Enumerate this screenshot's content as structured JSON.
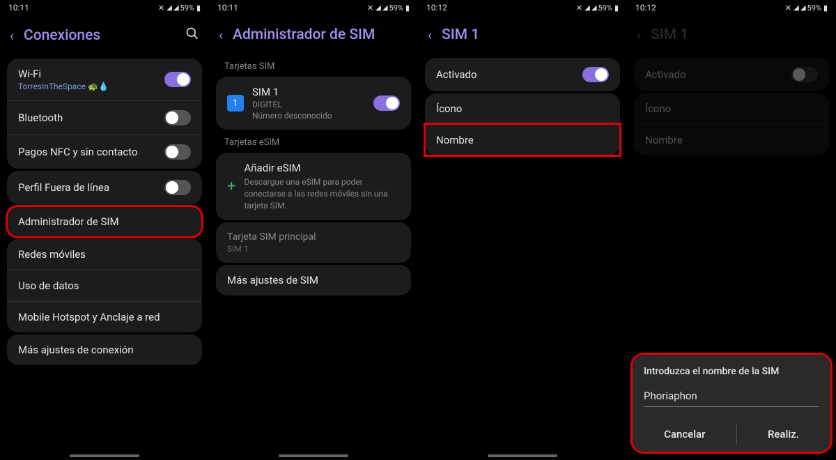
{
  "status": {
    "time1": "10:11",
    "time2": "10:11",
    "time3": "10:12",
    "time4": "10:12",
    "battery": "59%"
  },
  "screen1": {
    "title": "Conexiones",
    "wifi": {
      "label": "Wi-Fi",
      "ssid": "TorresInTheSpace 🐢💧"
    },
    "bluetooth": "Bluetooth",
    "nfc": "Pagos NFC y sin contacto",
    "offline": "Perfil Fuera de línea",
    "sim_manager": "Administrador de SIM",
    "mobile_networks": "Redes móviles",
    "data_usage": "Uso de datos",
    "hotspot": "Mobile Hotspot y Anclaje a red",
    "more": "Más ajustes de conexión"
  },
  "screen2": {
    "title": "Administrador de SIM",
    "section_sim": "Tarjetas SIM",
    "sim1": {
      "name": "SIM 1",
      "carrier": "DIGITEL",
      "number": "Número desconocido",
      "badge": "1"
    },
    "section_esim": "Tarjetas eSIM",
    "add_esim": {
      "label": "Añadir eSIM",
      "desc": "Descargue una eSIM para poder conectarse a las redes móviles sin una tarjeta SIM."
    },
    "primary": {
      "label": "Tarjeta SIM principal",
      "value": "SIM 1"
    },
    "more": "Más ajustes de SIM"
  },
  "screen3": {
    "title": "SIM 1",
    "activated": "Activado",
    "icon": "Ícono",
    "name": "Nombre"
  },
  "screen4": {
    "title": "SIM 1",
    "activated": "Activado",
    "icon": "Ícono",
    "name": "Nombre",
    "dialog": {
      "title": "Introduzca el nombre de la SIM",
      "value": "Phoriaphon",
      "cancel": "Cancelar",
      "ok": "Realiz."
    }
  }
}
